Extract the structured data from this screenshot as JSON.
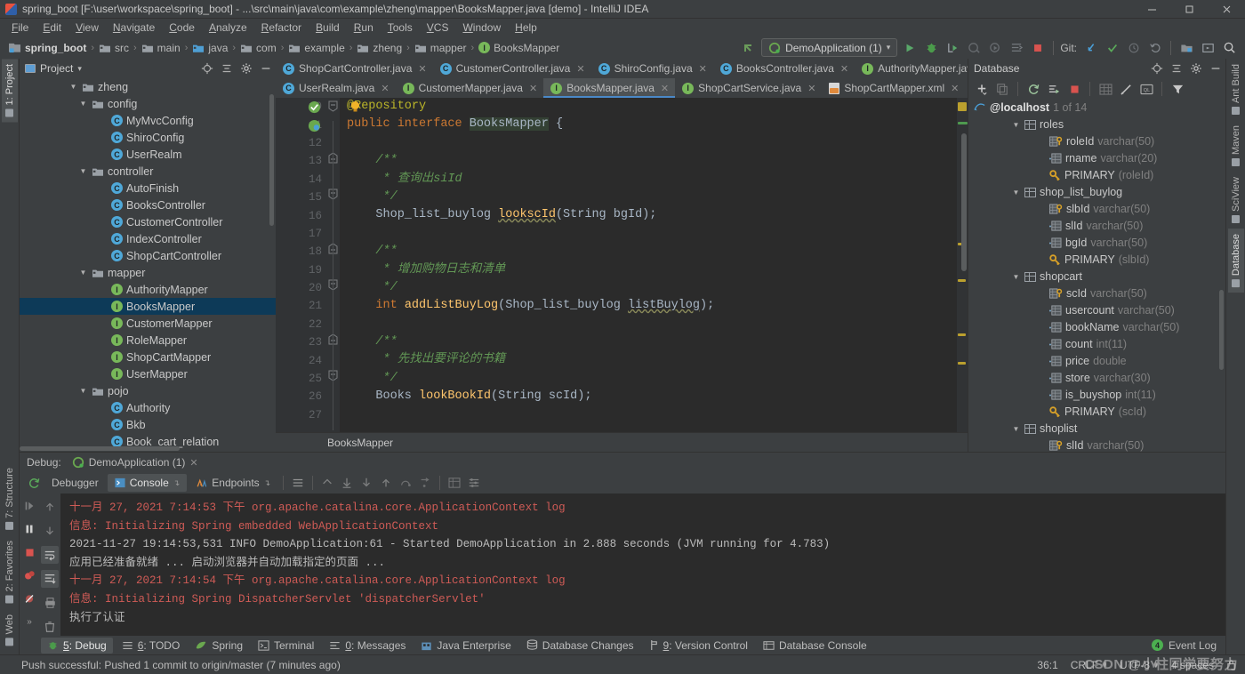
{
  "window": {
    "title": "spring_boot [F:\\user\\workspace\\spring_boot] - ...\\src\\main\\java\\com\\example\\zheng\\mapper\\BooksMapper.java [demo] - IntelliJ IDEA",
    "app_icon": "intellij-idea-icon",
    "minimize": "—",
    "maximize": "❐",
    "close": "✕"
  },
  "menubar": [
    {
      "label": "File"
    },
    {
      "label": "Edit"
    },
    {
      "label": "View"
    },
    {
      "label": "Navigate"
    },
    {
      "label": "Code"
    },
    {
      "label": "Analyze"
    },
    {
      "label": "Refactor"
    },
    {
      "label": "Build"
    },
    {
      "label": "Run"
    },
    {
      "label": "Tools"
    },
    {
      "label": "VCS"
    },
    {
      "label": "Window"
    },
    {
      "label": "Help"
    }
  ],
  "navbar": {
    "crumbs": [
      {
        "label": "spring_boot",
        "icon": "module-icon"
      },
      {
        "label": "src",
        "icon": "folder-icon"
      },
      {
        "label": "main",
        "icon": "folder-icon"
      },
      {
        "label": "java",
        "icon": "source-folder-icon"
      },
      {
        "label": "com",
        "icon": "package-icon"
      },
      {
        "label": "example",
        "icon": "package-icon"
      },
      {
        "label": "zheng",
        "icon": "package-icon"
      },
      {
        "label": "mapper",
        "icon": "package-icon"
      },
      {
        "label": "BooksMapper",
        "icon": "interface-icon"
      }
    ],
    "separator": "›",
    "run_config": "DemoApplication (1)",
    "git_label": "Git:",
    "icons": [
      "back-arrow-icon",
      "run-icon",
      "debug-icon",
      "run-with-coverage-icon",
      "profile-icon",
      "attach-icon",
      "stop-icon",
      "update-project-icon",
      "commit-icon",
      "history-icon",
      "rollback-icon",
      "search-everywhere-icon"
    ]
  },
  "left_rail": {
    "top": [
      {
        "label": "1: Project",
        "active": true
      }
    ],
    "bottom": [
      {
        "label": "7: Structure"
      },
      {
        "label": "2: Favorites"
      },
      {
        "label": "Web"
      }
    ]
  },
  "right_rail": [
    {
      "label": "Ant Build"
    },
    {
      "label": "Maven"
    },
    {
      "label": "SciView"
    },
    {
      "label": "Database",
      "active": true
    }
  ],
  "project_panel": {
    "title": "Project",
    "dropdown": "▾",
    "icons": [
      "locate-icon",
      "collapse-all-icon",
      "settings-icon",
      "hide-icon"
    ],
    "tree": [
      {
        "label": "zheng",
        "indent": 5,
        "icon": "package-icon",
        "twist": "▼"
      },
      {
        "label": "config",
        "indent": 6,
        "icon": "package-icon",
        "twist": "▼"
      },
      {
        "label": "MyMvcConfig",
        "indent": 8,
        "icon": "class-icon"
      },
      {
        "label": "ShiroConfig",
        "indent": 8,
        "icon": "class-icon"
      },
      {
        "label": "UserRealm",
        "indent": 8,
        "icon": "class-icon"
      },
      {
        "label": "controller",
        "indent": 6,
        "icon": "package-icon",
        "twist": "▼"
      },
      {
        "label": "AutoFinish",
        "indent": 8,
        "icon": "class-icon"
      },
      {
        "label": "BooksController",
        "indent": 8,
        "icon": "class-icon"
      },
      {
        "label": "CustomerController",
        "indent": 8,
        "icon": "class-icon"
      },
      {
        "label": "IndexController",
        "indent": 8,
        "icon": "class-icon"
      },
      {
        "label": "ShopCartController",
        "indent": 8,
        "icon": "class-icon"
      },
      {
        "label": "mapper",
        "indent": 6,
        "icon": "package-icon",
        "twist": "▼"
      },
      {
        "label": "AuthorityMapper",
        "indent": 8,
        "icon": "interface-icon"
      },
      {
        "label": "BooksMapper",
        "indent": 8,
        "icon": "interface-icon",
        "selected": true
      },
      {
        "label": "CustomerMapper",
        "indent": 8,
        "icon": "interface-icon"
      },
      {
        "label": "RoleMapper",
        "indent": 8,
        "icon": "interface-icon"
      },
      {
        "label": "ShopCartMapper",
        "indent": 8,
        "icon": "interface-icon"
      },
      {
        "label": "UserMapper",
        "indent": 8,
        "icon": "interface-icon"
      },
      {
        "label": "pojo",
        "indent": 6,
        "icon": "package-icon",
        "twist": "▼"
      },
      {
        "label": "Authority",
        "indent": 8,
        "icon": "class-icon"
      },
      {
        "label": "Bkb",
        "indent": 8,
        "icon": "class-icon"
      },
      {
        "label": "Book_cart_relation",
        "indent": 8,
        "icon": "class-icon"
      }
    ]
  },
  "editor": {
    "tabs_row1": [
      {
        "label": "ShopCartController.java",
        "icon": "class-icon",
        "closable": true
      },
      {
        "label": "CustomerController.java",
        "icon": "class-icon",
        "closable": true
      },
      {
        "label": "ShiroConfig.java",
        "icon": "class-icon",
        "closable": true
      },
      {
        "label": "BooksController.java",
        "icon": "class-icon",
        "closable": true
      },
      {
        "label": "AuthorityMapper.java",
        "icon": "interface-icon",
        "closable": true
      }
    ],
    "tabs_row2": [
      {
        "label": "UserRealm.java",
        "icon": "class-icon",
        "closable": true
      },
      {
        "label": "CustomerMapper.java",
        "icon": "interface-icon",
        "closable": true
      },
      {
        "label": "BooksMapper.java",
        "icon": "interface-icon",
        "closable": true,
        "active": true
      },
      {
        "label": "ShopCartService.java",
        "icon": "interface-icon",
        "closable": true
      },
      {
        "label": "ShopCartMapper.xml",
        "icon": "xml-file-icon",
        "closable": true
      }
    ],
    "breadcrumb": "BooksMapper",
    "first_line_number": 10,
    "lines": [
      {
        "n": 10,
        "html": "<span class=\"ann\">@Repository</span>"
      },
      {
        "n": 11,
        "html": "<span class=\"kw\">public interface</span> <span class=\"hl\">BooksMapper</span> {"
      },
      {
        "n": 12,
        "html": ""
      },
      {
        "n": 13,
        "html": "    <span class=\"cmt\">/**</span>"
      },
      {
        "n": 14,
        "html": "     <span class=\"cmt\">* 查询出siId</span>"
      },
      {
        "n": 15,
        "html": "     <span class=\"cmt\">*/</span>"
      },
      {
        "n": 16,
        "html": "    Shop_list_buylog <span class=\"meth wavy\">lookscId</span>(String bgId);"
      },
      {
        "n": 17,
        "html": ""
      },
      {
        "n": 18,
        "html": "    <span class=\"cmt\">/**</span>"
      },
      {
        "n": 19,
        "html": "     <span class=\"cmt\">* 增加购物日志和清单</span>"
      },
      {
        "n": 20,
        "html": "     <span class=\"cmt\">*/</span>"
      },
      {
        "n": 21,
        "html": "    <span class=\"kw\">int</span> <span class=\"meth\">addListBuyLog</span>(Shop_list_buylog <span class=\"wavy\">listBuylog</span>);"
      },
      {
        "n": 22,
        "html": ""
      },
      {
        "n": 23,
        "html": "    <span class=\"cmt\">/**</span>"
      },
      {
        "n": 24,
        "html": "     <span class=\"cmt\">* 先找出要评论的书籍</span>"
      },
      {
        "n": 25,
        "html": "     <span class=\"cmt\">*/</span>"
      },
      {
        "n": 26,
        "html": "    Books <span class=\"meth\">lookBookId</span>(String scId);"
      },
      {
        "n": 27,
        "html": ""
      }
    ]
  },
  "database_panel": {
    "title": "Database",
    "icons": [
      "add-icon",
      "duplicate-icon",
      "refresh-icon",
      "run-query-icon",
      "stop-icon",
      "table-icon",
      "edit-icon",
      "console-icon",
      "filter-icon"
    ],
    "connection": {
      "name": "@localhost",
      "info": "1 of 14",
      "icon": "mysql-icon"
    },
    "tree": [
      {
        "label": "roles",
        "indent": 2,
        "icon": "table-icon",
        "twist": "▼"
      },
      {
        "label": "roleId",
        "type": "varchar(50)",
        "indent": 4,
        "icon": "primary-column-icon"
      },
      {
        "label": "rname",
        "type": "varchar(20)",
        "indent": 4,
        "icon": "column-icon"
      },
      {
        "label": "PRIMARY",
        "type": "(roleId)",
        "indent": 4,
        "icon": "key-icon"
      },
      {
        "label": "shop_list_buylog",
        "indent": 2,
        "icon": "table-icon",
        "twist": "▼"
      },
      {
        "label": "slbId",
        "type": "varchar(50)",
        "indent": 4,
        "icon": "primary-column-icon"
      },
      {
        "label": "slId",
        "type": "varchar(50)",
        "indent": 4,
        "icon": "column-icon"
      },
      {
        "label": "bgId",
        "type": "varchar(50)",
        "indent": 4,
        "icon": "column-icon"
      },
      {
        "label": "PRIMARY",
        "type": "(slbId)",
        "indent": 4,
        "icon": "key-icon"
      },
      {
        "label": "shopcart",
        "indent": 2,
        "icon": "table-icon",
        "twist": "▼"
      },
      {
        "label": "scId",
        "type": "varchar(50)",
        "indent": 4,
        "icon": "primary-column-icon"
      },
      {
        "label": "usercount",
        "type": "varchar(50)",
        "indent": 4,
        "icon": "column-icon"
      },
      {
        "label": "bookName",
        "type": "varchar(50)",
        "indent": 4,
        "icon": "column-icon"
      },
      {
        "label": "count",
        "type": "int(11)",
        "indent": 4,
        "icon": "column-icon"
      },
      {
        "label": "price",
        "type": "double",
        "indent": 4,
        "icon": "column-icon"
      },
      {
        "label": "store",
        "type": "varchar(30)",
        "indent": 4,
        "icon": "column-icon"
      },
      {
        "label": "is_buyshop",
        "type": "int(11)",
        "indent": 4,
        "icon": "column-icon"
      },
      {
        "label": "PRIMARY",
        "type": "(scId)",
        "indent": 4,
        "icon": "key-icon"
      },
      {
        "label": "shoplist",
        "indent": 2,
        "icon": "table-icon",
        "twist": "▼"
      },
      {
        "label": "slId",
        "type": "varchar(50)",
        "indent": 4,
        "icon": "primary-column-icon"
      }
    ]
  },
  "debug_panel": {
    "header_label": "Debug:",
    "session": "DemoApplication (1)",
    "tabs": [
      {
        "label": "Debugger",
        "icon": "debugger-icon"
      },
      {
        "label": "Console",
        "icon": "console-icon",
        "active": true
      },
      {
        "label": "Endpoints",
        "icon": "endpoints-icon"
      }
    ],
    "console_lines": [
      {
        "text": "十一月 27, 2021 7:14:53 下午 org.apache.catalina.core.ApplicationContext log",
        "color": "red"
      },
      {
        "text": "信息: Initializing Spring embedded WebApplicationContext",
        "color": "red"
      },
      {
        "text": "2021-11-27 19:14:53,531  INFO DemoApplication:61 - Started DemoApplication in 2.888 seconds (JVM running for 4.783)",
        "color": "white"
      },
      {
        "text": "应用已经准备就绪 ... 启动浏览器并自动加载指定的页面 ...",
        "color": "white"
      },
      {
        "text": "十一月 27, 2021 7:14:54 下午 org.apache.catalina.core.ApplicationContext log",
        "color": "red"
      },
      {
        "text": "信息: Initializing Spring DispatcherServlet 'dispatcherServlet'",
        "color": "red"
      },
      {
        "text": "执行了认证",
        "color": "white"
      }
    ]
  },
  "bottom_toolbar": [
    {
      "label": "5: Debug",
      "icon": "debug-icon",
      "active": true
    },
    {
      "label": "6: TODO",
      "icon": "todo-icon"
    },
    {
      "label": "Spring",
      "icon": "spring-icon"
    },
    {
      "label": "Terminal",
      "icon": "terminal-icon"
    },
    {
      "label": "0: Messages",
      "icon": "messages-icon"
    },
    {
      "label": "Java Enterprise",
      "icon": "java-enterprise-icon"
    },
    {
      "label": "Database Changes",
      "icon": "database-changes-icon"
    },
    {
      "label": "9: Version Control",
      "icon": "version-control-icon"
    },
    {
      "label": "Database Console",
      "icon": "database-console-icon"
    }
  ],
  "event_log": {
    "label": "Event Log",
    "badge": "4"
  },
  "statusbar": {
    "message": "Push successful: Pushed 1 commit to origin/master (7 minutes ago)",
    "caret": "36:1",
    "line_sep": "CRLF",
    "encoding": "UTF-8",
    "indent": "4 spaces"
  },
  "watermark": "CSDN @小柱同学要努力",
  "colors": {
    "chrome": "#3c3f41",
    "editor_bg": "#2b2b2b",
    "accent_blue": "#4a88c7",
    "selection": "#0d3a58",
    "keyword": "#cc7832",
    "comment": "#629755",
    "annotation": "#bbb529",
    "method": "#ffc66d",
    "log_red": "#cf5b56"
  }
}
